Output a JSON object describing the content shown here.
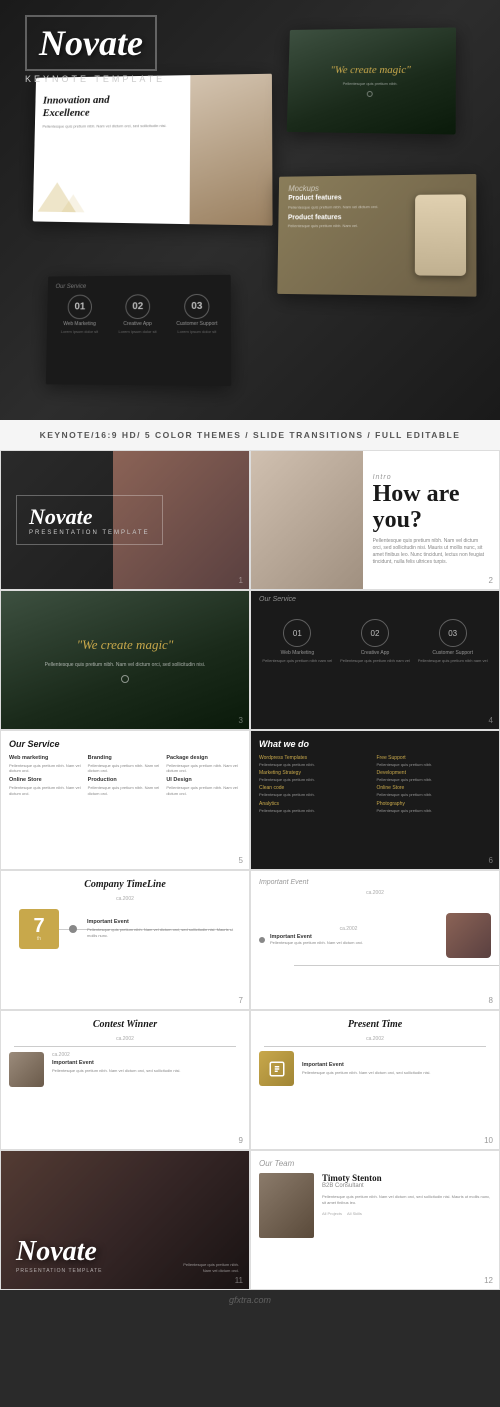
{
  "brand": {
    "name": "Novate",
    "subtitle": "KEYNOTE TEMPLATE"
  },
  "features": {
    "text": "KEYNOTE/16:9 HD/ 5 COLOR THEMES / SLIDE TRANSITIONS / FULL EDITABLE"
  },
  "slides": [
    {
      "id": 1,
      "label": "",
      "number": "1",
      "title": "Novate",
      "subtitle": "PRESENTATION TEMPLATE",
      "theme": "dark"
    },
    {
      "id": 2,
      "label": "Intro",
      "number": "2",
      "title": "How are you?",
      "text": "Pellentesque quis pretium nibh. Nam vel dictum orci, sed sollicitudin nisi. Mauris ut mollis nunc, sit amet finibus leo. Nunc tincidunt, lectus non feugiat tincidunt, nulla felis ultrices turpis.",
      "theme": "light"
    },
    {
      "id": 3,
      "label": "",
      "number": "3",
      "quote": "\"We create magic\"",
      "text": "Pellentesque quis pretium nibh. Nam vel dictum orci, sed sollicitudin nisi.",
      "theme": "forest"
    },
    {
      "id": 4,
      "label": "Our Service",
      "number": "4",
      "services": [
        {
          "num": "01",
          "title": "Web Marketing",
          "desc": "Pellentesque quis pretium nibh nam vel"
        },
        {
          "num": "02",
          "title": "Creative App",
          "desc": "Pellentesque quis pretium nibh nam vel"
        },
        {
          "num": "03",
          "title": "Customer Support",
          "desc": "Pellentesque quis pretium nibh nam vel"
        }
      ],
      "theme": "dark"
    },
    {
      "id": 5,
      "label": "Our Service",
      "number": "5",
      "services": [
        {
          "title": "Web marketing",
          "desc": "Pellentesque quis pretium nibh. Nam vel dictum orci."
        },
        {
          "title": "Branding",
          "desc": "Pellentesque quis pretium nibh. Nam vel dictum orci."
        },
        {
          "title": "Package design",
          "desc": "Pellentesque quis pretium nibh. Nam vel dictum orci."
        },
        {
          "title": "Online Store",
          "desc": "Pellentesque quis pretium nibh. Nam vel dictum orci."
        },
        {
          "title": "Production",
          "desc": "Pellentesque quis pretium nibh. Nam vel dictum orci."
        },
        {
          "title": "UI Design",
          "desc": "Pellentesque quis pretium nibh. Nam vel dictum orci."
        }
      ],
      "theme": "light"
    },
    {
      "id": 6,
      "label": "What we do",
      "number": "6",
      "services": [
        {
          "title": "Wordpress Templates",
          "desc": "Pellentesque quis pretium nibh."
        },
        {
          "title": "Free Support",
          "desc": "Pellentesque quis pretium nibh."
        },
        {
          "title": "Marketing Strategy",
          "desc": "Pellentesque quis pretium nibh."
        },
        {
          "title": "Development",
          "desc": "Pellentesque quis pretium nibh."
        },
        {
          "title": "Clean code",
          "desc": "Pellentesque quis pretium nibh."
        },
        {
          "title": "Online Store",
          "desc": "Pellentesque quis pretium nibh."
        },
        {
          "title": "Analytics",
          "desc": "Pellentesque quis pretium nibh."
        },
        {
          "title": "Photography",
          "desc": "Pellentesque quis pretium nibh."
        }
      ],
      "theme": "dark"
    },
    {
      "id": 7,
      "label": "Company TimeLine",
      "number": "7",
      "year": "ca.2002",
      "big_number": "7",
      "event_title": "Important Event",
      "event_text": "Pellentesque quis pretium nibh. Nam vel dictum orci, sed sollicitudin nisi. Mauris ut mollis nunc.",
      "theme": "light"
    },
    {
      "id": 8,
      "label": "",
      "number": "8",
      "year": "ca.2002",
      "event_title": "Important Event",
      "event_text": "Pellentesque quis pretium nibh. Nam vel dictum orci, sed sollicitudin nisi.",
      "theme": "light"
    },
    {
      "id": 9,
      "label": "Contest Winner",
      "number": "9",
      "year": "ca.2002",
      "event_title": "Important Event",
      "event_text": "Pellentesque quis pretium nibh. Nam vel dictum orci, sed sollicitudin nisi.",
      "theme": "light"
    },
    {
      "id": 10,
      "label": "Present Time",
      "number": "10",
      "year": "ca.2002",
      "event_title": "Important Event",
      "event_text": "Pellentesque quis pretium nibh. Nam vel dictum orci, sed sollicitudin nisi.",
      "theme": "light"
    },
    {
      "id": 11,
      "label": "",
      "number": "11",
      "title": "Novate",
      "subtitle": "PRESENTATION TEMPLATE",
      "theme": "dark-photo"
    },
    {
      "id": 12,
      "label": "Our Team",
      "number": "12",
      "person": {
        "name": "Timoty Stenton",
        "role": "B2B Consultant",
        "desc": "Pellentesque quis pretium nibh. Nam vel dictum orci, sed sollicitudin nisi. Mauris ut mollis nunc, sit amet finibus leo."
      },
      "theme": "light"
    }
  ]
}
